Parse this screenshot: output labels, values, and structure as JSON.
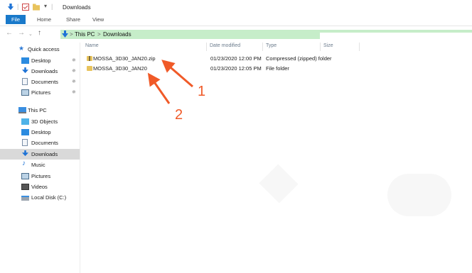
{
  "window": {
    "title": "Downloads"
  },
  "ribbon": {
    "tabs": [
      "File",
      "Home",
      "Share",
      "View"
    ]
  },
  "address": {
    "crumbs": [
      "This PC",
      "Downloads"
    ],
    "separator": ">"
  },
  "nav_icons": {
    "back": "arrow-left-icon",
    "forward": "arrow-right-icon",
    "recent": "chevron-down-icon",
    "up": "arrow-up-icon"
  },
  "sidebar": {
    "quick_access": {
      "label": "Quick access",
      "items": [
        {
          "label": "Desktop",
          "icon": "desktop-icon",
          "pinned": true
        },
        {
          "label": "Downloads",
          "icon": "download-icon",
          "pinned": true
        },
        {
          "label": "Documents",
          "icon": "documents-icon",
          "pinned": true
        },
        {
          "label": "Pictures",
          "icon": "pictures-icon",
          "pinned": true
        }
      ]
    },
    "this_pc": {
      "label": "This PC",
      "items": [
        {
          "label": "3D Objects",
          "icon": "3d-objects-icon"
        },
        {
          "label": "Desktop",
          "icon": "desktop-icon"
        },
        {
          "label": "Documents",
          "icon": "documents-icon"
        },
        {
          "label": "Downloads",
          "icon": "download-icon",
          "selected": true
        },
        {
          "label": "Music",
          "icon": "music-icon"
        },
        {
          "label": "Pictures",
          "icon": "pictures-icon"
        },
        {
          "label": "Videos",
          "icon": "videos-icon"
        },
        {
          "label": "Local Disk (C:)",
          "icon": "drive-icon"
        }
      ]
    }
  },
  "columns": [
    "Name",
    "Date modified",
    "Type",
    "Size"
  ],
  "files": [
    {
      "name": "MOSSA_3D30_JAN20.zip",
      "date": "01/23/2020 12:00 PM",
      "type": "Compressed (zipped) folder",
      "size": "",
      "icon": "zip-folder-icon"
    },
    {
      "name": "MOSSA_3D30_JAN20",
      "date": "01/23/2020 12:05 PM",
      "type": "File folder",
      "size": "",
      "icon": "folder-icon"
    }
  ],
  "annotations": {
    "labels": [
      "1",
      "2"
    ],
    "color": "#f05a28"
  },
  "colors": {
    "file_tab": "#1979ca",
    "address_bar": "#c6edc9",
    "download_arrow": "#1e73d6",
    "annotation": "#f05a28"
  }
}
